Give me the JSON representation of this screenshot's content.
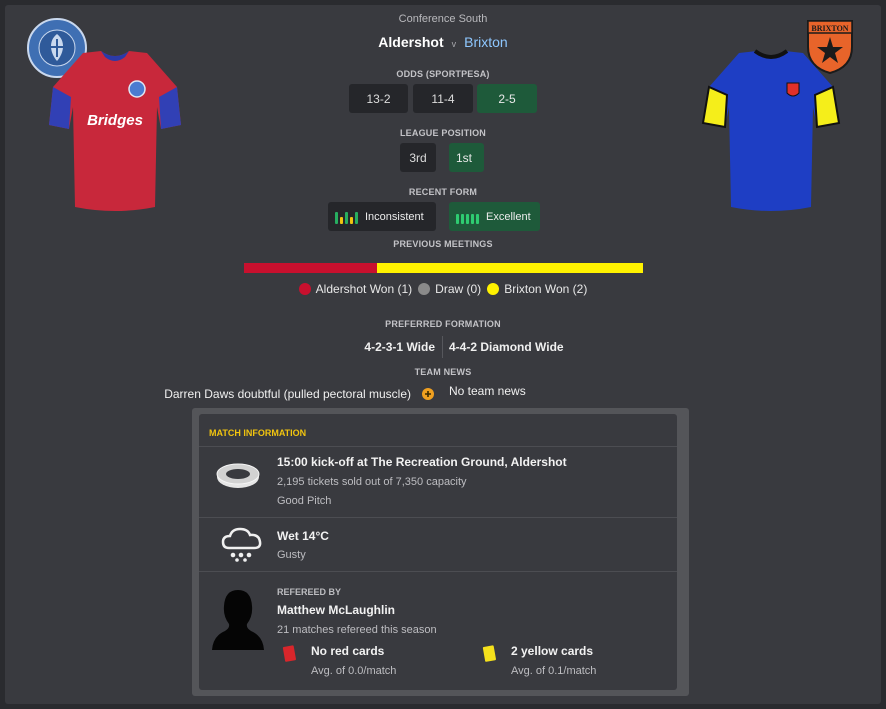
{
  "competition": "Conference South",
  "home_team": {
    "name": "Aldershot",
    "badge_text": "ALDERSHOT TOWN F.C.",
    "badge_sub": "THE RISING PHOENIX 1992",
    "sponsor": "Bridges"
  },
  "versus": "v",
  "away_team": {
    "name": "Brixton",
    "badge_text": "BRIXTON"
  },
  "odds": {
    "label": "ODDS (SPORTPESA)",
    "home": "13-2",
    "draw": "11-4",
    "away": "2-5"
  },
  "league_position": {
    "label": "LEAGUE POSITION",
    "home": "3rd",
    "away": "1st"
  },
  "recent_form": {
    "label": "RECENT FORM",
    "home": "Inconsistent",
    "away": "Excellent"
  },
  "previous_meetings": {
    "label": "PREVIOUS MEETINGS",
    "home_won": 1,
    "draw": 0,
    "away_won": 2,
    "home_label": "Aldershot Won (1)",
    "draw_label": "Draw (0)",
    "away_label": "Brixton Won (2)"
  },
  "preferred_formation": {
    "label": "PREFERRED FORMATION",
    "home": "4-2-3-1 Wide",
    "away": "4-4-2 Diamond Wide"
  },
  "team_news": {
    "label": "TEAM NEWS",
    "home": "Darren Daws doubtful (pulled pectoral muscle)",
    "away": "No team news"
  },
  "match_info": {
    "title": "MATCH INFORMATION",
    "kickoff": "15:00 kick-off at The Recreation Ground, Aldershot",
    "tickets": "2,195 tickets sold out of 7,350 capacity",
    "pitch": "Good Pitch",
    "weather": "Wet 14°C",
    "wind": "Gusty",
    "refereed_by": "REFEREED BY",
    "referee": "Matthew McLaughlin",
    "ref_matches": "21 matches refereed this season",
    "red_cards": "No red cards",
    "red_avg": "Avg. of 0.0/match",
    "yellow_cards": "2 yellow cards",
    "yellow_avg": "Avg. of 0.1/match"
  },
  "colors": {
    "home": "#c8102e",
    "away": "#fff200",
    "draw": "#8a8a8a",
    "good_green": "#1e5a3a",
    "accent_gold": "#f1c40f"
  }
}
